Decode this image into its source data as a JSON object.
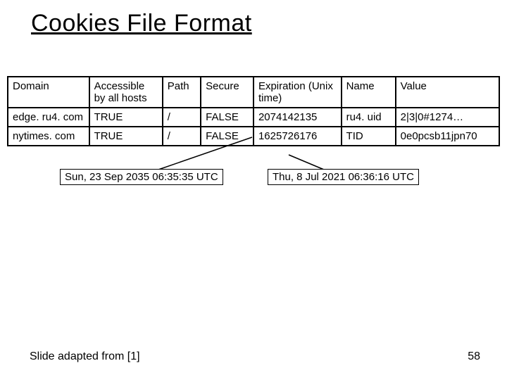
{
  "title": "Cookies File Format",
  "table": {
    "headers": [
      "Domain",
      "Accessible by all hosts",
      "Path",
      "Secure",
      "Expiration (Unix time)",
      "Name",
      "Value"
    ],
    "rows": [
      [
        "edge. ru4. com",
        "TRUE",
        "/",
        "FALSE",
        "2074142135",
        "ru4. uid",
        "2|3|0#1274…"
      ],
      [
        "nytimes. com",
        "TRUE",
        "/",
        "FALSE",
        "1625726176",
        "TID",
        "0e0pcsb11jpn70"
      ]
    ]
  },
  "annotations": {
    "left": "Sun, 23 Sep 2035 06:35:35 UTC",
    "right": "Thu, 8 Jul 2021 06:36:16 UTC"
  },
  "footer": {
    "left": "Slide adapted from [1]",
    "right": "58"
  }
}
